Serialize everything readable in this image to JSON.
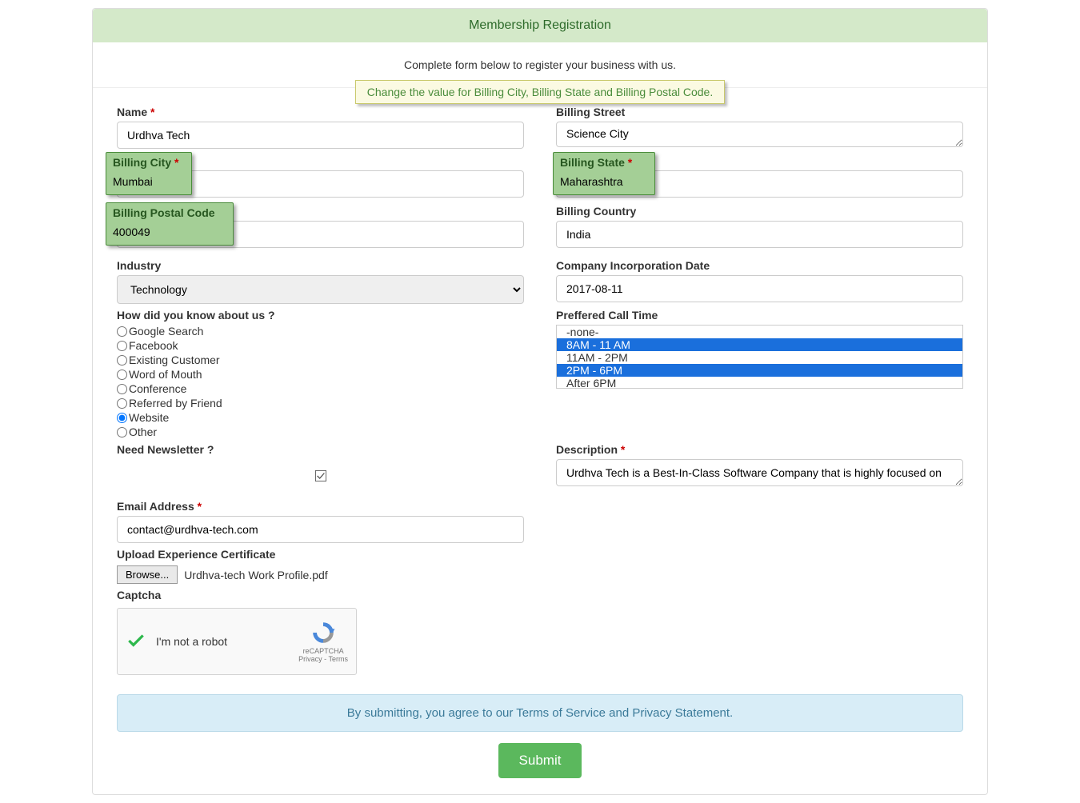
{
  "header": {
    "title": "Membership Registration",
    "subtitle": "Complete form below to register your business with us."
  },
  "alert": {
    "message": "Change the value for Billing City, Billing State and Billing Postal Code."
  },
  "fields": {
    "name": {
      "label": "Name",
      "value": "Urdhva Tech",
      "required": "*"
    },
    "billing_street": {
      "label": "Billing Street",
      "value": "Science City"
    },
    "billing_city": {
      "label": "Billing City",
      "value": "Mumbai",
      "required": "*"
    },
    "billing_state": {
      "label": "Billing State",
      "value": "Maharashtra",
      "required": "*"
    },
    "billing_postal": {
      "label": "Billing Postal Code",
      "value": "400049"
    },
    "billing_country": {
      "label": "Billing Country",
      "value": "India"
    },
    "industry": {
      "label": "Industry",
      "value": "Technology"
    },
    "incorp_date": {
      "label": "Company Incorporation Date",
      "value": "2017-08-11"
    },
    "lead_source": {
      "label": "How did you know about us ?",
      "options": [
        "Google Search",
        "Facebook",
        "Existing Customer",
        "Word of Mouth",
        "Conference",
        "Referred by Friend",
        "Website",
        "Other"
      ],
      "selected": "Website"
    },
    "call_time": {
      "label": "Preffered Call Time",
      "options": [
        "-none-",
        "8AM - 11 AM",
        "11AM - 2PM",
        "2PM - 6PM",
        "After 6PM"
      ],
      "selected": [
        "8AM - 11 AM",
        "2PM - 6PM"
      ]
    },
    "newsletter": {
      "label": "Need Newsletter ?",
      "checked": true
    },
    "description": {
      "label": "Description",
      "required": "*",
      "value": "Urdhva Tech is a Best-In-Class Software Company that is highly focused on"
    },
    "email": {
      "label": "Email Address",
      "required": "*",
      "value": "contact@urdhva-tech.com"
    },
    "upload": {
      "label": "Upload Experience Certificate",
      "button": "Browse...",
      "filename": "Urdhva-tech Work Profile.pdf"
    },
    "captcha": {
      "label": "Captcha",
      "text": "I'm not a robot",
      "brand": "reCAPTCHA",
      "links": "Privacy - Terms"
    }
  },
  "consent": {
    "text": "By submitting, you agree to our Terms of Service and Privacy Statement."
  },
  "submit": {
    "label": "Submit"
  }
}
